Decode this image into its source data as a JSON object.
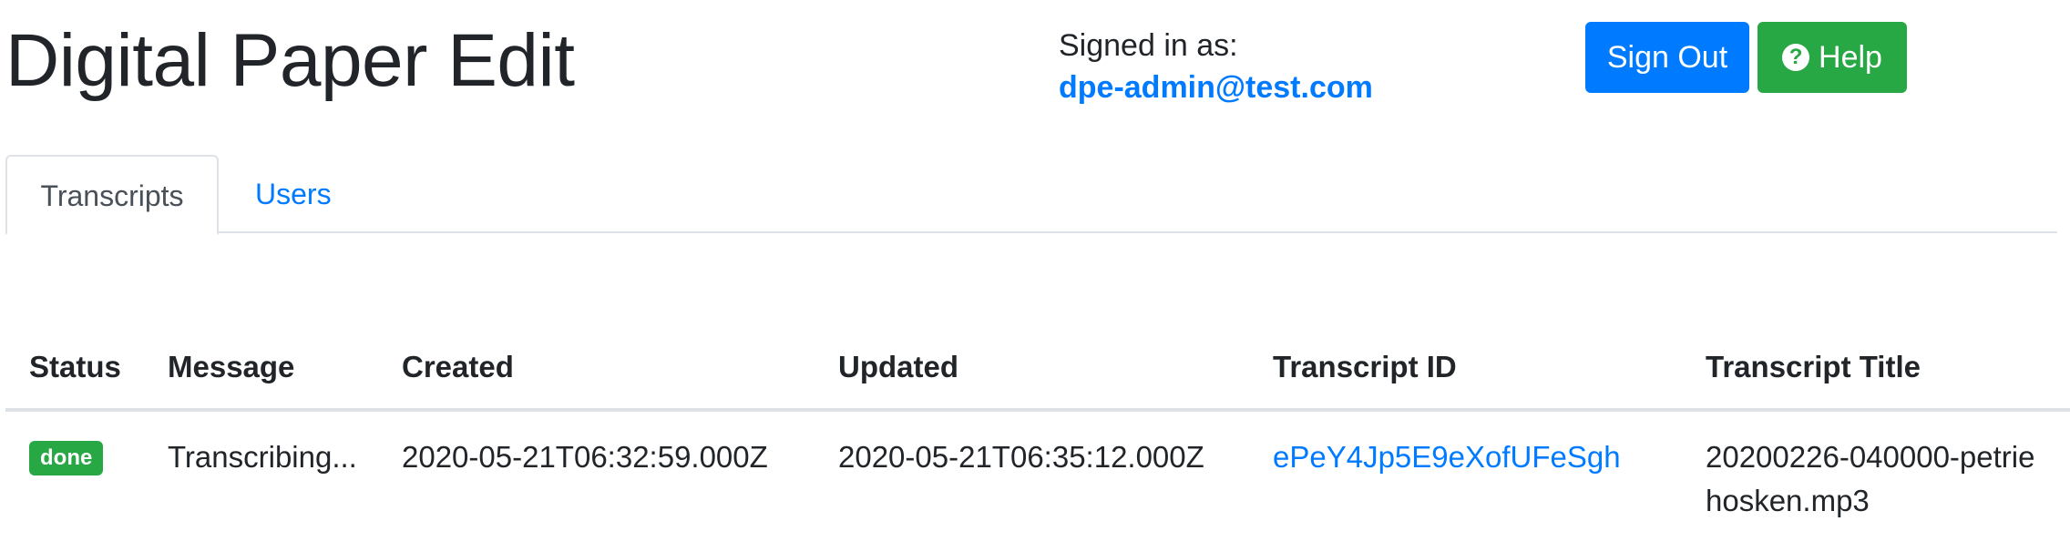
{
  "header": {
    "title": "Digital Paper Edit",
    "signed_in_label": "Signed in as:",
    "user_email": "dpe-admin@test.com",
    "sign_out_label": "Sign Out",
    "help_label": "Help"
  },
  "tabs": [
    {
      "label": "Transcripts",
      "active": true
    },
    {
      "label": "Users",
      "active": false
    }
  ],
  "table": {
    "columns": [
      "Status",
      "Message",
      "Created",
      "Updated",
      "Transcript ID",
      "Transcript Title"
    ],
    "rows": [
      {
        "status": "done",
        "message": "Transcribing...",
        "created": "2020-05-21T06:32:59.000Z",
        "updated": "2020-05-21T06:35:12.000Z",
        "transcript_id": "ePeY4Jp5E9eXofUFeSgh",
        "transcript_title_line1": "20200226-040000-petrie",
        "transcript_title_line2": "hosken.mp3"
      }
    ]
  },
  "colors": {
    "primary": "#007bff",
    "success": "#28a745",
    "text": "#212529",
    "border": "#dee2e6"
  },
  "icons": {
    "help": "question-circle-icon"
  }
}
